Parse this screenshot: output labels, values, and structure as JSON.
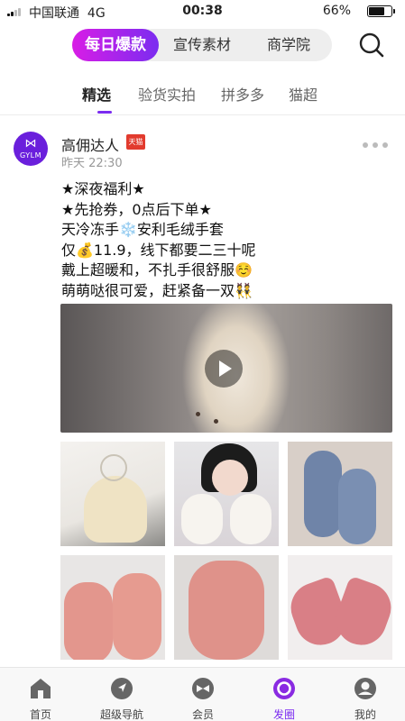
{
  "status_bar": {
    "carrier": "中国联通",
    "network": "4G",
    "time": "00:38",
    "battery": "66%",
    "battery_level": 0.66
  },
  "top_segments": [
    "每日爆款",
    "宣传素材",
    "商学院"
  ],
  "active_segment": 0,
  "sub_tabs": [
    "精选",
    "验货实拍",
    "拼多多",
    "猫超"
  ],
  "active_sub_tab": 0,
  "post": {
    "avatar_text": "GYLM",
    "author": "高佣达人",
    "badge": "天猫",
    "time": "昨天 22:30",
    "lines": [
      "★深夜福利★",
      "★先抢券，0点后下单★",
      "天冷冻手❄️安利毛绒手套",
      "仅💰11.9，线下都要二三十呢",
      "戴上超暖和，不扎手很舒服☺️",
      "萌萌哒很可爱，赶紧备一双👯"
    ]
  },
  "tab_bar": [
    "首页",
    "超级导航",
    "会员",
    "发圈",
    "我的"
  ],
  "active_tab": 3,
  "colors": {
    "accent_start": "#d81de6",
    "accent_end": "#7b2cf0",
    "tmall_red": "#e23b2e"
  },
  "icons": [
    "signal-icon",
    "battery-icon",
    "search-icon",
    "more-icon",
    "play-icon",
    "home-icon",
    "navigate-icon",
    "member-icon",
    "circle-icon",
    "profile-icon"
  ]
}
